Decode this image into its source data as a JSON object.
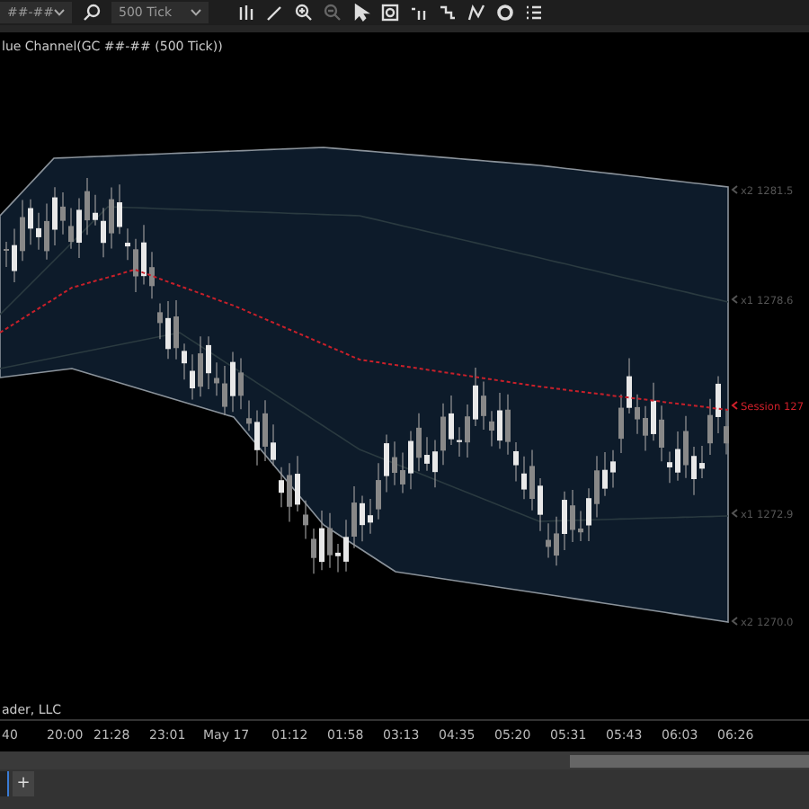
{
  "toolbar": {
    "instrument": "##-##",
    "interval": "500 Tick"
  },
  "chart": {
    "title": "lue Channel(GC ##-## (500 Tick))",
    "copyright": "ader, LLC",
    "band_labels": [
      {
        "kind": "band",
        "text": "x2 1281.5"
      },
      {
        "kind": "band",
        "text": "x1 1278.6"
      },
      {
        "kind": "session",
        "text": "Session 127"
      },
      {
        "kind": "band",
        "text": "x1 1272.9"
      },
      {
        "kind": "band",
        "text": "x2 1270.0"
      }
    ]
  },
  "time_axis": [
    "40",
    "20:00",
    "21:28",
    "23:01",
    "May 17",
    "01:12",
    "01:58",
    "03:13",
    "04:35",
    "05:20",
    "05:31",
    "05:43",
    "06:03",
    "06:26"
  ],
  "tabs": {
    "add": "+"
  }
}
